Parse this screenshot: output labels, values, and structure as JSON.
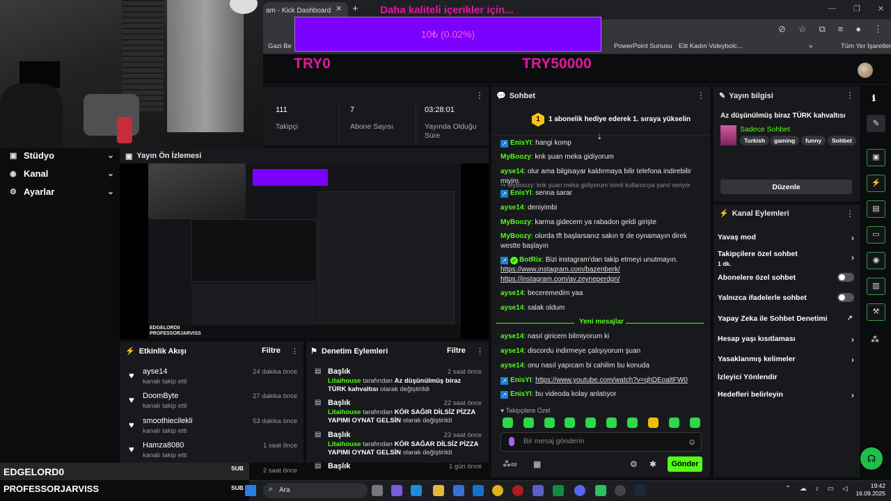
{
  "browser": {
    "tab_title": "am - Kick Dashboard",
    "bookmarks": [
      "Gazi Be",
      "PowerPoint Sunusu",
      "Elit Kadın Voleybolc...",
      "Tüm Yer İşaretleri"
    ]
  },
  "goal": {
    "title": "Daha kaliteli içerikler için...",
    "progress_text": "10₺ (0.02%)",
    "progress_fraction": 0.0002,
    "min_label": "TRY0",
    "max_label": "TRY50000"
  },
  "sidebar": {
    "items": [
      {
        "label": "Stüdyo"
      },
      {
        "label": "Kanal"
      },
      {
        "label": "Ayarlar"
      }
    ]
  },
  "stats": [
    {
      "value": "111",
      "label": "Takipçi"
    },
    {
      "value": "7",
      "label": "Abone Sayısı"
    },
    {
      "value": "03:28:01",
      "label": "Yayında Olduğu Süre"
    }
  ],
  "preview": {
    "title": "Yayın Ön İzlemesi",
    "overlay_names": [
      "EDGELORD0",
      "PROFESSORJARVISS"
    ]
  },
  "activity": {
    "title": "Etkinlik Akışı",
    "filter": "Filtre",
    "items": [
      {
        "name": "ayse14",
        "desc": "kanalı takip etti",
        "time": "24 dakika önce"
      },
      {
        "name": "DoomByte",
        "desc": "kanalı takip etti",
        "time": "27 dakika önce"
      },
      {
        "name": "smoothiecilekli",
        "desc": "kanalı takip etti",
        "time": "53 dakika önce"
      },
      {
        "name": "Hamza8080",
        "desc": "kanalı takip etti",
        "time": "1 saat önce"
      },
      {
        "name": "",
        "desc": "",
        "time": "2 saat önce"
      }
    ]
  },
  "moderation": {
    "title": "Denetim Eylemleri",
    "filter": "Filtre",
    "items": [
      {
        "title": "Başlık",
        "time": "2 saat önce",
        "user": "Litaihouse",
        "by": "tarafından",
        "value": "Az düşünülmüş biraz TÜRK kahvaltısı",
        "suffix": "olarak değiştirildi"
      },
      {
        "title": "Başlık",
        "time": "22 saat önce",
        "user": "Litaihouse",
        "by": "tarafından",
        "value": "KÖR SAĞIR DİLSİZ PİZZA YAPIMI OYNAT GELSİN",
        "suffix": "olarak değiştirildi"
      },
      {
        "title": "Başlık",
        "time": "23 saat önce",
        "user": "Litaihouse",
        "by": "tarafından",
        "value": "KÖR SAĞAR DİLSİZ PİZZA YAPIMI OYNAT GELSİN",
        "suffix": "olarak değiştirildi"
      },
      {
        "title": "Başlık",
        "time": "1 gün önce",
        "user": "",
        "by": "",
        "value": "",
        "suffix": ""
      }
    ]
  },
  "overlay_bottom": {
    "name1": "EDGELORD0",
    "sub1": "SUB",
    "name2": "PROFESSORJARVISS",
    "sub2": "SUB"
  },
  "chat": {
    "title": "Sohbet",
    "pinned": "1 abonelik hediye ederek 1. sıraya yükselin",
    "pinned_rank": "1",
    "messages": [
      {
        "user": "EnisYI",
        "color": "#53fc18",
        "text": "hangi komp"
      },
      {
        "user": "MyBoozy",
        "color": "#53fc18",
        "text": "knk şuan meka gidiyorum"
      },
      {
        "user": "ayse14",
        "color": "#53fc18",
        "text": "olur ama bilgisayar kaldırmaya bilir telefona indirebilir miyim"
      },
      {
        "reply": "MyBoozy: knk şuan meka gidiyorum isimli kullanıcıya yanıt veriyor"
      },
      {
        "user": "EnisYI",
        "color": "#53fc18",
        "text": "senna sarar"
      },
      {
        "user": "ayse14",
        "color": "#53fc18",
        "text": "deniyimbi"
      },
      {
        "user": "MyBoozy",
        "color": "#53fc18",
        "text": "karma gidecem ya rabadon geldi girişte"
      },
      {
        "user": "MyBoozy",
        "color": "#53fc18",
        "text": "olurda tft başlarsanız sakın tr de oynamayın direk westte başlayın"
      },
      {
        "user": "BotRix",
        "color": "#53fc18",
        "text": "Bizi instagram'dan takip etmeyi unutmayın.",
        "links": [
          "https://www.instagram.com/bazenberk/",
          "https://instagram.com/av.zeyneperdgn/"
        ]
      },
      {
        "user": "ayse14",
        "color": "#53fc18",
        "text": "beceremedim yaa"
      },
      {
        "user": "ayse14",
        "color": "#53fc18",
        "text": "salak oldum"
      },
      {
        "user": "ayse14",
        "color": "#53fc18",
        "text": "nasıl giricem bilmiyorum ki"
      },
      {
        "user": "ayse14",
        "color": "#53fc18",
        "text": "discordu indirmeye çalışıyorum şuan"
      },
      {
        "user": "ayse14",
        "color": "#53fc18",
        "text": "onu nasıl yapıcam bi cahilim bu konuda"
      },
      {
        "user": "EnisYI",
        "color": "#53fc18",
        "text": "https://www.youtube.com/watch?v=qhDEoaltFW0"
      },
      {
        "user": "EnisYI",
        "color": "#53fc18",
        "text": "bu videoda kolay anlatıyor"
      }
    ],
    "new_messages": "Yeni mesajlar",
    "followers_only": "Takipçilere Özel",
    "input_placeholder": "Bir mesaj gönderin",
    "send_label": "Gönder"
  },
  "stream_info": {
    "title": "Yayın bilgisi",
    "stream_title": "Az düşünülmüş biraz TÜRK kahvaltısı",
    "category": "Sadece Sohbet",
    "tags": [
      "Turkish",
      "gaming",
      "funny",
      "Sohbet"
    ],
    "edit_label": "Düzenle"
  },
  "channel_actions": {
    "title": "Kanal Eylemleri",
    "items": [
      {
        "label": "Yavaş mod",
        "control": "chevron"
      },
      {
        "label": "Takipçilere özel sohbet",
        "sub": "1 dk.",
        "control": "chevron"
      },
      {
        "label": "Abonelere özel sohbet",
        "control": "toggle",
        "on": false
      },
      {
        "label": "Yalnızca ifadelerle sohbet",
        "control": "toggle",
        "on": false
      },
      {
        "label": "Yapay Zeka ile Sohbet Denetimi",
        "control": "external"
      },
      {
        "label": "Hesap yaşı kısıtlaması",
        "control": "chevron"
      },
      {
        "label": "Yasaklanmış kelimeler",
        "control": "chevron"
      },
      {
        "label": "İzleyici Yönlendir",
        "control": "none"
      },
      {
        "label": "Hedefleri belirleyin",
        "control": "chevron"
      }
    ]
  },
  "taskbar": {
    "search_placeholder": "Ara",
    "time": "19:42",
    "date": "16.09.2025"
  },
  "colors": {
    "accent": "#53fc18",
    "goal_pink": "#e2179f",
    "goal_bar": "#7a00ff",
    "panel": "#18191c"
  }
}
